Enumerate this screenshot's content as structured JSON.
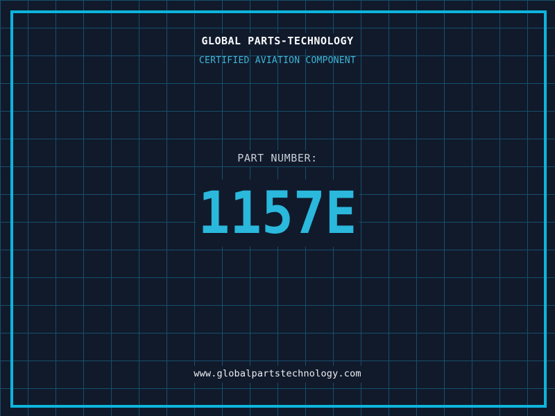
{
  "header": {
    "title": "GLOBAL PARTS-TECHNOLOGY",
    "subtitle": "CERTIFIED AVIATION COMPONENT"
  },
  "part": {
    "label": "PART NUMBER:",
    "number": "1157E"
  },
  "footer": {
    "website": "www.globalpartstechnology.com"
  },
  "colors": {
    "background": "#101a2b",
    "grid_line": "#184f6c",
    "frame": "#0db5dc",
    "title_text": "#f8f9fa",
    "subtitle_text": "#3fb6d8",
    "label_text": "#c9ced8",
    "number_text": "#2ab8dc",
    "url_text": "#eef0f2"
  }
}
